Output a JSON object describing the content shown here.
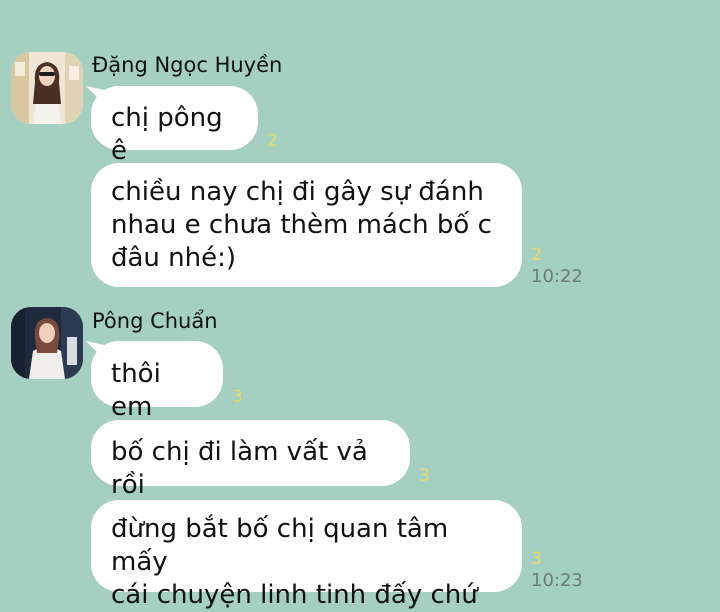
{
  "conversation": {
    "groups": [
      {
        "sender": "Đặng Ngọc Huyền",
        "avatar_icon": "profile-photo-huyen",
        "messages": [
          {
            "lines": [
              "chị pông ê"
            ],
            "seen": "2",
            "time": ""
          },
          {
            "lines": [
              "chiều nay chị đi gây sự đánh",
              "nhau e chưa thèm mách bố c",
              "đâu nhé:)"
            ],
            "seen": "2",
            "time": "10:22"
          }
        ]
      },
      {
        "sender": "Pông Chuẩn",
        "avatar_icon": "profile-photo-chuan",
        "messages": [
          {
            "lines": [
              "thôi em"
            ],
            "seen": "3",
            "time": ""
          },
          {
            "lines": [
              "bố chị đi làm vất vả rồi"
            ],
            "seen": "3",
            "time": ""
          },
          {
            "lines": [
              "đừng bắt bố chị quan tâm mấy",
              "cái chuyện linh tinh đấy chứ"
            ],
            "seen": "3",
            "time": "10:23"
          }
        ]
      }
    ]
  },
  "colors": {
    "background": "#a5cfc1",
    "bubble": "#ffffff",
    "read_count": "#e9d96a",
    "timestamp": "#6a7d77"
  }
}
